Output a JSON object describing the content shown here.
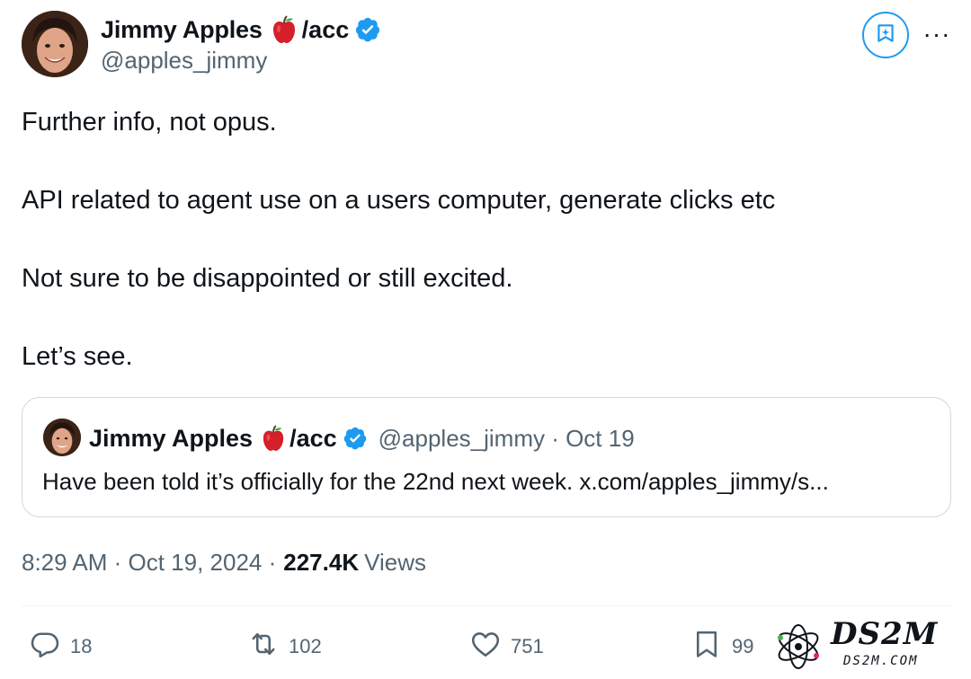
{
  "author": {
    "display_name": "Jimmy Apples",
    "name_suffix": "/acc",
    "handle": "@apples_jimmy",
    "verified": true,
    "emoji": "red-apple"
  },
  "header": {
    "grok_icon": "grok-icon",
    "more_label": "···"
  },
  "tweet": {
    "paragraphs": [
      "Further info, not opus.",
      "API related to agent use on a users computer, generate clicks etc",
      "Not sure to be disappointed or still excited.",
      "Let’s see."
    ]
  },
  "quoted_tweet": {
    "display_name": "Jimmy Apples",
    "name_suffix": "/acc",
    "handle_date": "@apples_jimmy · Oct 19",
    "text": "Have been told it’s officially for the 22nd next week. x.com/apples_jimmy/s..."
  },
  "meta": {
    "timestamp": "8:29 AM · Oct 19, 2024 ·",
    "views_count": "227.4K",
    "views_label": "Views"
  },
  "actions": {
    "replies": "18",
    "reposts": "102",
    "likes": "751",
    "bookmarks": "99"
  },
  "watermark": {
    "text": "DS2M",
    "sub": "DS2M.COM"
  },
  "colors": {
    "accent": "#1d9bf0",
    "text_primary": "#0f1419",
    "text_secondary": "#536471",
    "border": "#cfd9de",
    "apple_red": "#d3202a"
  }
}
